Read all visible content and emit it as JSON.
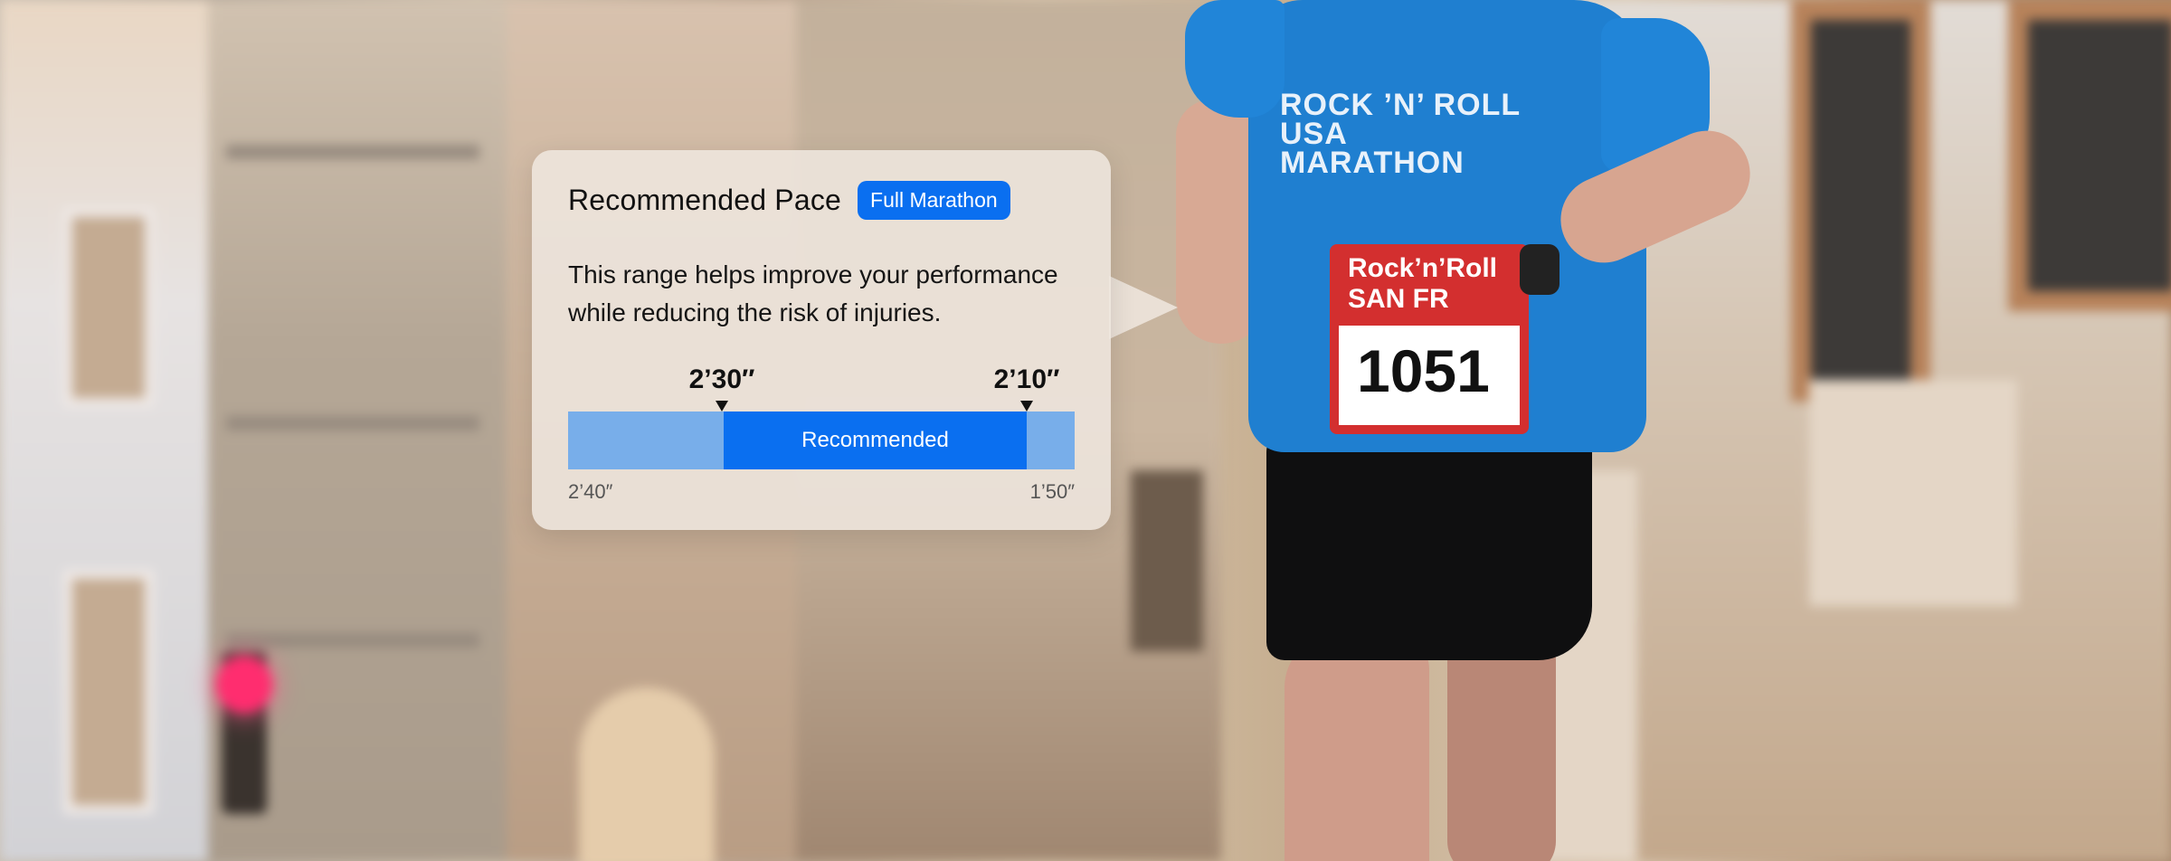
{
  "card": {
    "title": "Recommended Pace",
    "badge": "Full Marathon",
    "description": "This range helps improve your performance while reducing the risk of injuries.",
    "range": {
      "marker_left": "2’30″",
      "marker_right": "2’10″",
      "bar_label": "Recommended",
      "min_label": "2’40″",
      "max_label": "1’50″"
    }
  },
  "photo": {
    "shirt_text": "ROCK ’N’ ROLL USA MARATHON",
    "bib_header": "Rock’n’Roll SAN FR",
    "bib_number": "1051"
  },
  "colors": {
    "accent": "#0a6ff0",
    "range_track": "#78aeea",
    "card_bg": "#eee6de"
  }
}
